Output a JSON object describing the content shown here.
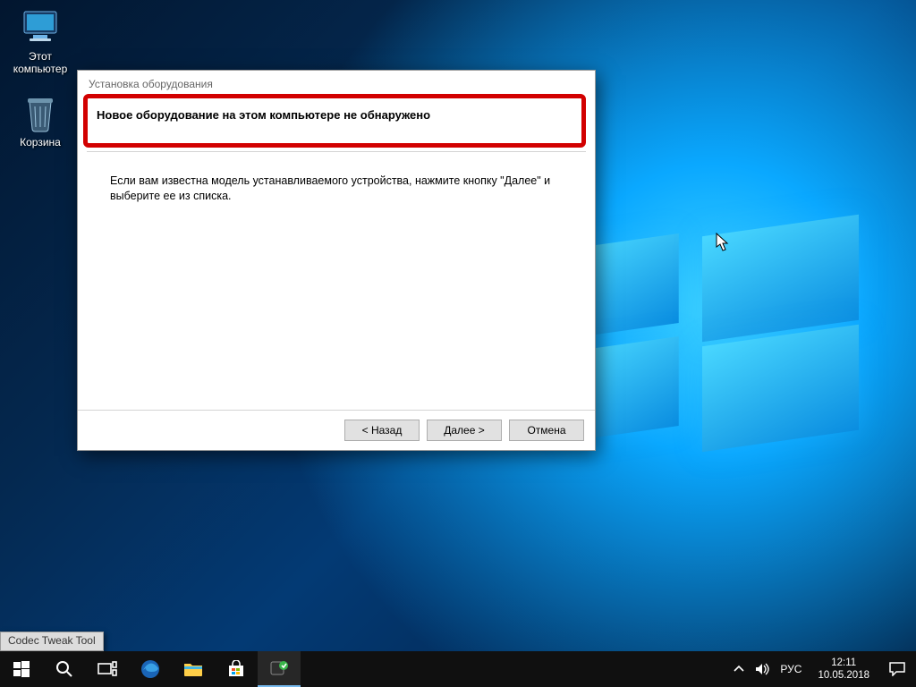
{
  "desktop": {
    "icons": {
      "this_pc": {
        "label": "Этот\nкомпьютер"
      },
      "recycle_bin": {
        "label": "Корзина"
      }
    },
    "tooltip": "Codec Tweak Tool"
  },
  "wizard": {
    "title": "Установка оборудования",
    "heading": "Новое оборудование на этом компьютере не обнаружено",
    "body": "Если вам известна модель устанавливаемого устройства, нажмите кнопку \"Далее\" и выберите ее из списка.",
    "buttons": {
      "back": "< Назад",
      "next": "Далее >",
      "cancel": "Отмена"
    }
  },
  "taskbar": {
    "icons": {
      "start": "start-icon",
      "search": "search-icon",
      "taskview": "task-view-icon",
      "edge": "edge-icon",
      "explorer": "file-explorer-icon",
      "store": "store-icon",
      "app": "hardware-wizard-icon"
    },
    "tray": {
      "up": "chevron-up-icon",
      "volume": "volume-icon",
      "lang": "РУС",
      "time": "12:11",
      "date": "10.05.2018",
      "notifications": "action-center-icon"
    }
  },
  "colors": {
    "accent": "#0078d7",
    "highlight": "#d20000"
  }
}
